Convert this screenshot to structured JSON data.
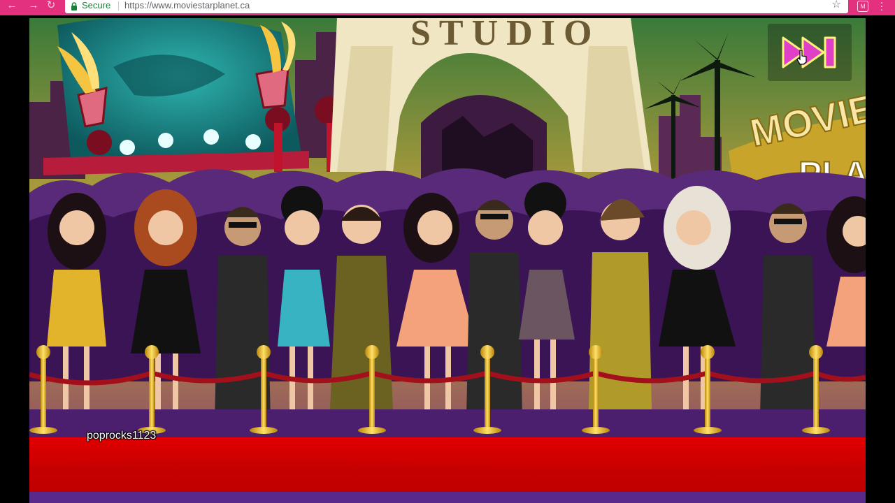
{
  "browser": {
    "secure_label": "Secure",
    "url": "https://www.moviestarplanet.ca",
    "accent_color": "#e3317f"
  },
  "game": {
    "studio_sign": "STUDIO",
    "logo_text": "MOVIE",
    "logo_text_2": "PLA",
    "username": "poprocks1123",
    "skip_button_icon": "fast-forward-icon"
  }
}
